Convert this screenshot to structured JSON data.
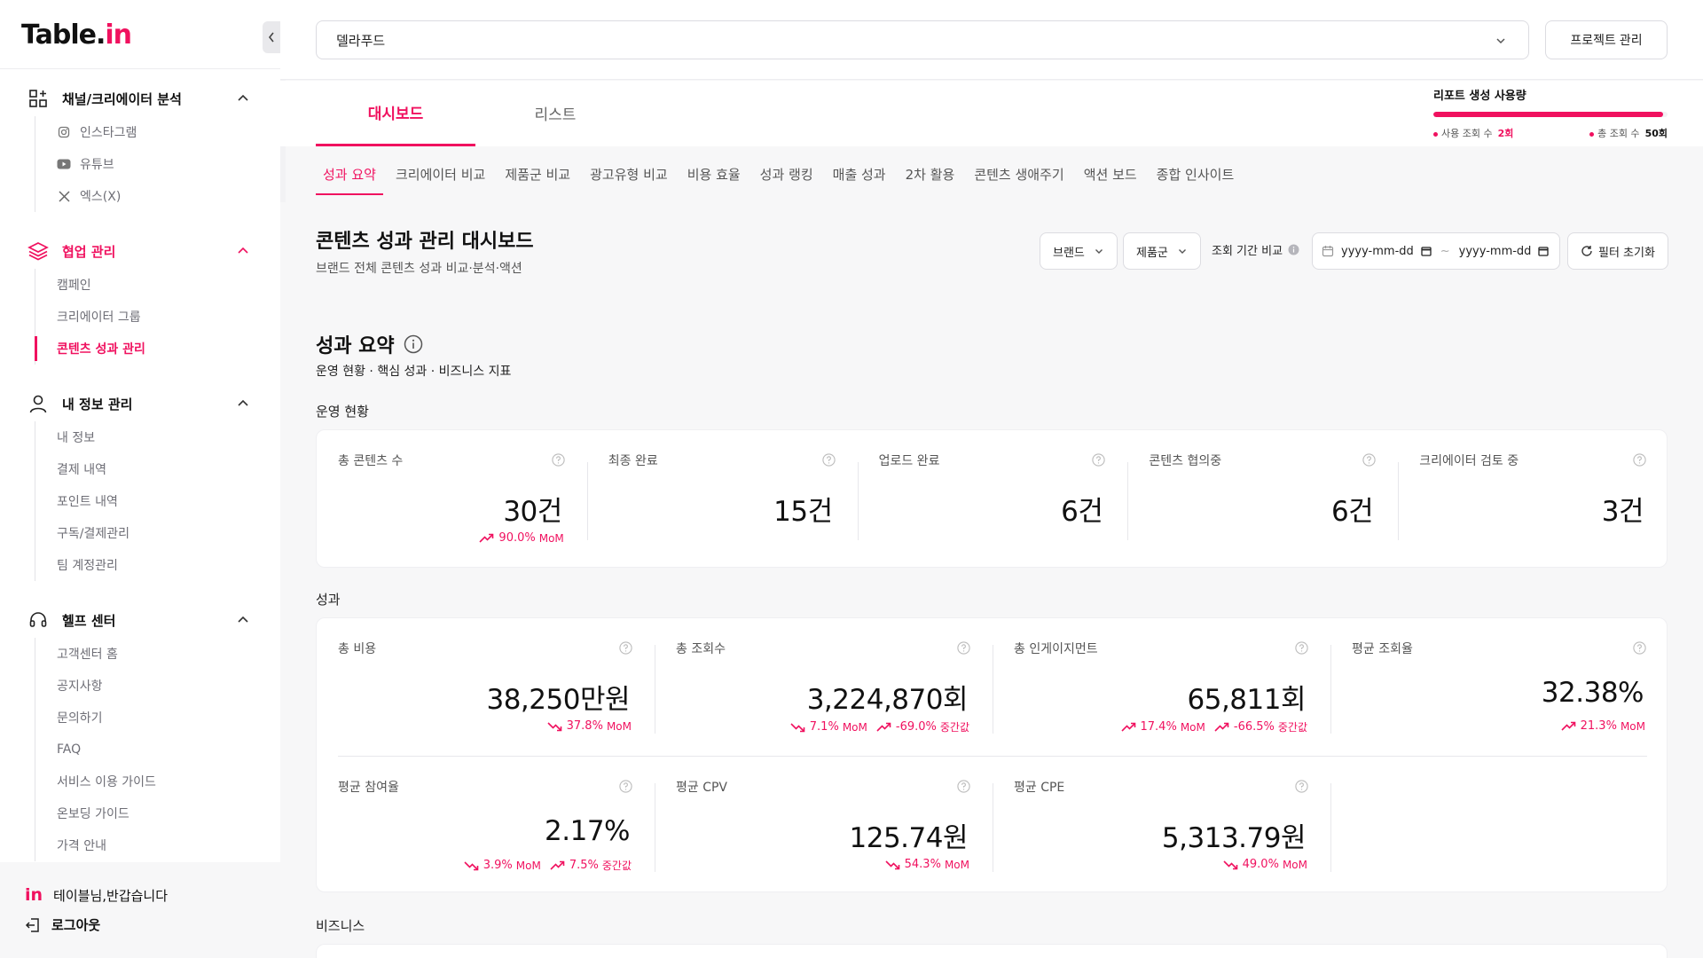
{
  "sidebar": {
    "logo_main": "Table.",
    "logo_accent": "in",
    "sections": [
      {
        "label": "채널/크리에이터 분석",
        "icon": "grid-plus-icon",
        "items": [
          {
            "label": "인스타그램",
            "icon": "instagram-icon"
          },
          {
            "label": "유튜브",
            "icon": "youtube-icon"
          },
          {
            "label": "엑스(X)",
            "icon": "x-icon"
          }
        ]
      },
      {
        "label": "협업 관리",
        "icon": "layers-icon",
        "items": [
          {
            "label": "캠페인"
          },
          {
            "label": "크리에이터 그룹"
          },
          {
            "label": "콘텐츠 성과 관리"
          }
        ]
      },
      {
        "label": "내 정보 관리",
        "icon": "user-icon",
        "items": [
          {
            "label": "내 정보"
          },
          {
            "label": "결제 내역"
          },
          {
            "label": "포인트 내역"
          },
          {
            "label": "구독/결제관리"
          },
          {
            "label": "팀 계정관리"
          }
        ]
      },
      {
        "label": "헬프 센터",
        "icon": "headset-icon",
        "items": [
          {
            "label": "고객센터 홈"
          },
          {
            "label": "공지사항"
          },
          {
            "label": "문의하기"
          },
          {
            "label": "FAQ"
          },
          {
            "label": "서비스 이용 가이드"
          },
          {
            "label": "온보딩 가이드"
          },
          {
            "label": "가격 안내"
          }
        ]
      }
    ],
    "footer": {
      "logo": "in",
      "greeting": "테이블님,반갑습니다",
      "logout": "로그아웃"
    }
  },
  "topbar": {
    "project": "델라푸드",
    "project_button": "프로젝트 관리"
  },
  "tabs": [
    "대시보드",
    "리스트"
  ],
  "usage": {
    "title": "리포트 생성 사용량",
    "used_label": "사용 조회 수",
    "used_value": "2회",
    "total_label": "총 조회 수",
    "total_value": "50회",
    "fill_fraction": 0.98
  },
  "subtabs": [
    "성과 요약",
    "크리에이터 비교",
    "제품군 비교",
    "광고유형 비교",
    "비용 효율",
    "성과 랭킹",
    "매출 성과",
    "2차 활용",
    "콘텐츠 생애주기",
    "액션 보드",
    "종합 인사이트"
  ],
  "page": {
    "title": "콘텐츠 성과 관리 대시보드",
    "subtitle": "브랜드 전체 콘텐츠 성과 비교·분석·액션"
  },
  "filters": {
    "brand": "브랜드",
    "product": "제품군",
    "period_label": "조회 기간 비교",
    "date_from": "yyyy-mm-dd",
    "tilde": "~",
    "date_to": "yyyy-mm-dd",
    "reset": "필터 초기화"
  },
  "summary": {
    "title": "성과 요약",
    "subtitle": "운영 현황 · 핵심 성과 · 비즈니스 지표"
  },
  "groups": {
    "operations": "운영 현황",
    "performance": "성과",
    "business": "비즈니스"
  },
  "operations": [
    {
      "label": "총 콘텐츠 수",
      "value": "30건",
      "delta": [
        {
          "dir": "up",
          "text": "90.0%",
          "suffix": "MoM"
        }
      ]
    },
    {
      "label": "최종 완료",
      "value": "15건",
      "delta": []
    },
    {
      "label": "업로드 완료",
      "value": "6건",
      "delta": []
    },
    {
      "label": "콘텐츠 협의중",
      "value": "6건",
      "delta": []
    },
    {
      "label": "크리에이터 검토 중",
      "value": "3건",
      "delta": []
    }
  ],
  "performance": [
    {
      "label": "총 비용",
      "value": "38,250만원",
      "delta": [
        {
          "dir": "down",
          "text": "37.8%",
          "suffix": "MoM"
        }
      ]
    },
    {
      "label": "총 조회수",
      "value": "3,224,870회",
      "delta": [
        {
          "dir": "down",
          "text": "7.1%",
          "suffix": "MoM"
        },
        {
          "dir": "up",
          "text": "-69.0%",
          "suffix": "중간값"
        }
      ]
    },
    {
      "label": "총 인게이지먼트",
      "value": "65,811회",
      "delta": [
        {
          "dir": "up",
          "text": "17.4%",
          "suffix": "MoM"
        },
        {
          "dir": "up",
          "text": "-66.5%",
          "suffix": "중간값"
        }
      ]
    },
    {
      "label": "평균 조회율",
      "value": "32.38%",
      "delta": [
        {
          "dir": "up",
          "text": "21.3%",
          "suffix": "MoM"
        }
      ]
    },
    {
      "label": "평균 참여율",
      "value": "2.17%",
      "delta": [
        {
          "dir": "down",
          "text": "3.9%",
          "suffix": "MoM"
        },
        {
          "dir": "up",
          "text": "7.5%",
          "suffix": "중간값"
        }
      ]
    },
    {
      "label": "평균 CPV",
      "value": "125.74원",
      "delta": [
        {
          "dir": "down",
          "text": "54.3%",
          "suffix": "MoM"
        }
      ]
    },
    {
      "label": "평균 CPE",
      "value": "5,313.79원",
      "delta": [
        {
          "dir": "down",
          "text": "49.0%",
          "suffix": "MoM"
        }
      ]
    }
  ],
  "colors": {
    "accent": "#f0115f",
    "text": "#111111",
    "muted": "#6e6e76",
    "background": "#f7f7f8"
  }
}
